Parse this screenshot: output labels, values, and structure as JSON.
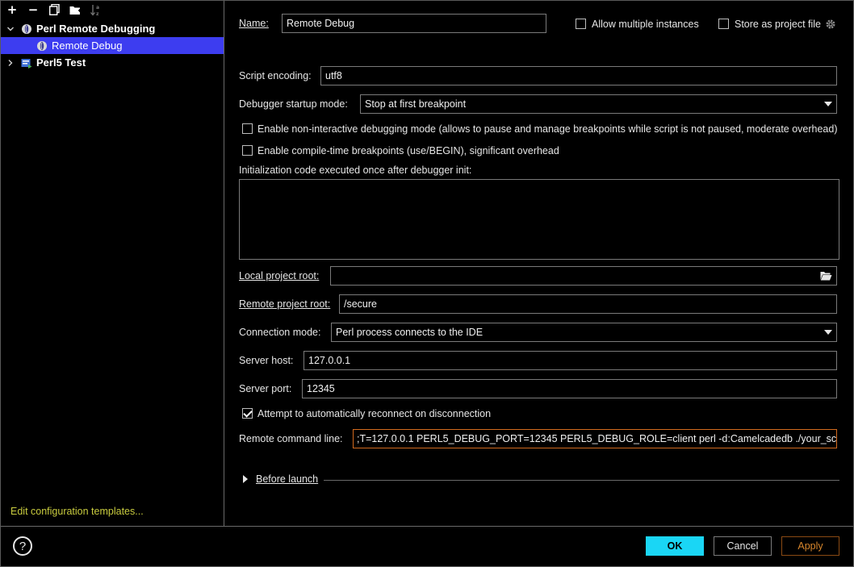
{
  "toolbar": {
    "add_label": "+",
    "remove_label": "−"
  },
  "tree": {
    "groups": [
      {
        "label": "Perl Remote Debugging",
        "expanded": true,
        "icon": "perl-onion-icon"
      },
      {
        "label": "Perl5 Test",
        "expanded": false,
        "icon": "perl-test-icon"
      }
    ],
    "selected_item": {
      "label": "Remote Debug",
      "icon": "perl-onion-icon"
    }
  },
  "edit_templates_link": "Edit configuration templates...",
  "form": {
    "name_label": "Name:",
    "name_value": "Remote Debug",
    "allow_multiple_label": "Allow multiple instances",
    "store_project_label": "Store as project file",
    "script_encoding_label": "Script encoding:",
    "script_encoding_value": "utf8",
    "startup_mode_label": "Debugger startup mode:",
    "startup_mode_value": "Stop at first breakpoint",
    "noninteractive_label": "Enable non-interactive debugging mode (allows to pause and manage breakpoints while script is not paused, moderate overhead)",
    "compiletime_label": "Enable compile-time breakpoints (use/BEGIN), significant overhead",
    "init_code_label": "Initialization code executed once after debugger init:",
    "local_root_label": "Local project root:",
    "local_root_value": "",
    "remote_root_label": "Remote project root:",
    "remote_root_value": "/secure",
    "connection_mode_label": "Connection mode:",
    "connection_mode_value": "Perl process connects to the IDE",
    "server_host_label": "Server host:",
    "server_host_value": "127.0.0.1",
    "server_port_label": "Server port:",
    "server_port_value": "12345",
    "reconnect_label": "Attempt to automatically reconnect on disconnection",
    "remote_cmd_label": "Remote command line:",
    "remote_cmd_value": ";T=127.0.0.1 PERL5_DEBUG_PORT=12345 PERL5_DEBUG_ROLE=client perl -d:Camelcadedb ./your_script.pl",
    "before_launch_label": "Before launch"
  },
  "checkboxes": {
    "allow_multiple": false,
    "store_project": false,
    "noninteractive": false,
    "compiletime": false,
    "reconnect": true
  },
  "buttons": {
    "help": "?",
    "ok": "OK",
    "cancel": "Cancel",
    "apply": "Apply"
  },
  "colors": {
    "selection": "#3d3df0",
    "ok_button": "#1ad6f5",
    "link": "#c9cc3f",
    "apply_text": "#d7862c",
    "highlight_border": "#d26a1e"
  }
}
